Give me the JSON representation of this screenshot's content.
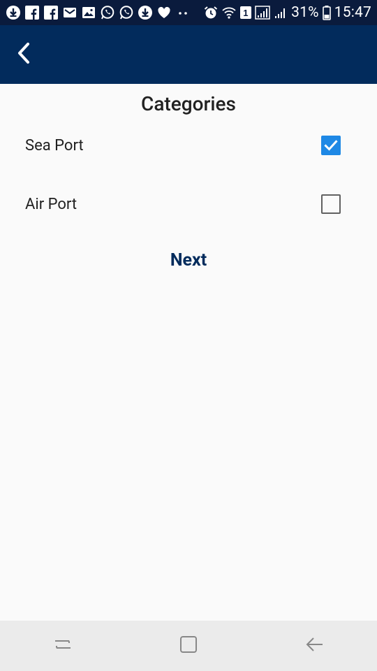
{
  "status_bar": {
    "battery": "31%",
    "time": "15:47",
    "sim_slot": "1",
    "icons": [
      "download-icon",
      "facebook-icon",
      "facebook-icon",
      "gmail-icon",
      "gallery-icon",
      "whatsapp-icon",
      "whatsapp-icon",
      "download-icon",
      "heart-icon",
      "more-dots-icon"
    ]
  },
  "app_bar": {
    "back_icon": "chevron-left-icon"
  },
  "page": {
    "title": "Categories",
    "categories": [
      {
        "label": "Sea Port",
        "checked": true
      },
      {
        "label": "Air Port",
        "checked": false
      }
    ],
    "next_label": "Next"
  },
  "nav_bar": {
    "buttons": [
      "recent-apps-icon",
      "home-icon",
      "back-arrow-icon"
    ]
  },
  "colors": {
    "status_bar_bg": "#0a1b3d",
    "app_bar_bg": "#022b5c",
    "checkbox_checked": "#1e88e5",
    "next_text": "#022b5c",
    "nav_bar_bg": "#ebebeb"
  }
}
